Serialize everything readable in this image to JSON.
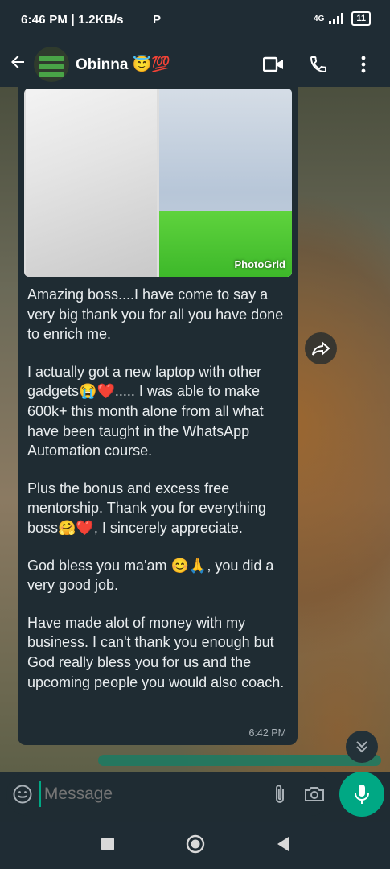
{
  "status_bar": {
    "time_speed": "6:46 PM | 1.2KB/s",
    "network": "4G",
    "battery": "11",
    "extra_icon": "P"
  },
  "header": {
    "contact_name": "Obinna 😇💯",
    "back_icon": "arrow-left",
    "icons": [
      "video-call-icon",
      "phone-call-icon",
      "more-vertical-icon"
    ]
  },
  "message": {
    "image_caption": "PhotoGrid",
    "paragraphs": [
      "Amazing boss....I have come to say a very big thank you for all you have done to enrich me.",
      "I actually got a new laptop with other gadgets😭❤️..... I was able to make 600k+ this month alone from all what have been taught in the WhatsApp Automation course.",
      "Plus the bonus and excess free mentorship. Thank you for everything boss🤗❤️, I sincerely appreciate.",
      "God bless you ma'am 😊🙏, you did a very good job.",
      "Have made alot of money with my business. I can't thank you enough but God really bless you for us and the upcoming people you would also coach."
    ],
    "time": "6:42 PM"
  },
  "input": {
    "placeholder": "Message"
  },
  "colors": {
    "accent": "#00a884",
    "bubble": "#1f2c33",
    "bar": "#1f2c34"
  }
}
